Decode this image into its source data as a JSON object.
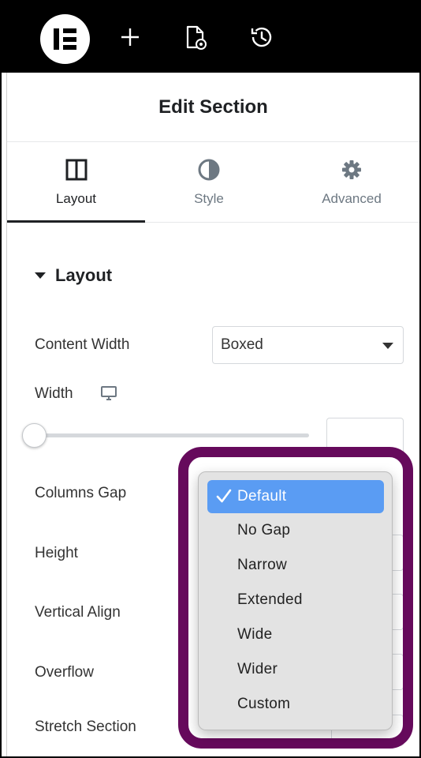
{
  "panel": {
    "title": "Edit Section"
  },
  "tabs": [
    {
      "label": "Layout",
      "icon": "columns-icon",
      "active": true
    },
    {
      "label": "Style",
      "icon": "half-circle-icon",
      "active": false
    },
    {
      "label": "Advanced",
      "icon": "gear-icon",
      "active": false
    }
  ],
  "section": {
    "title": "Layout"
  },
  "controls": {
    "content_width": {
      "label": "Content Width",
      "value": "Boxed"
    },
    "width": {
      "label": "Width",
      "icon": "desktop-icon",
      "slider_value": 0
    },
    "columns_gap": {
      "label": "Columns Gap"
    },
    "height": {
      "label": "Height"
    },
    "vertical_align": {
      "label": "Vertical Align"
    },
    "overflow": {
      "label": "Overflow"
    },
    "stretch_section": {
      "label": "Stretch Section"
    }
  },
  "dropdown": {
    "selected": "Default",
    "options": [
      "Default",
      "No Gap",
      "Narrow",
      "Extended",
      "Wide",
      "Wider",
      "Custom"
    ]
  },
  "colors": {
    "highlight": "#660a5c",
    "selected_option": "#5a9cf3",
    "topbar": "#000000"
  }
}
